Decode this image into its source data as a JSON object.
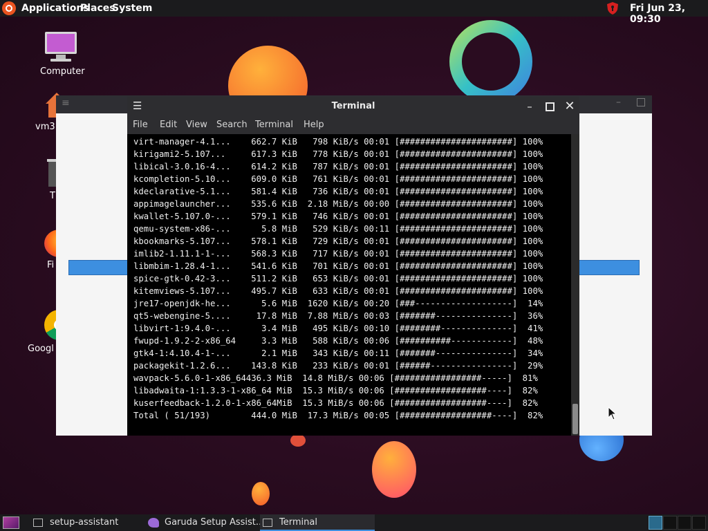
{
  "top_panel": {
    "menu_applications": "Applications",
    "menu_places": "Places",
    "menu_system": "System",
    "clock": "Fri Jun 23, 09:30"
  },
  "desktop_icons": [
    {
      "label": "Computer",
      "icon": "computer-icon"
    },
    {
      "label": "vm3",
      "icon": "home-folder-icon"
    },
    {
      "label": "T",
      "icon": "trash-icon"
    },
    {
      "label": "Fi",
      "icon": "firefox-icon"
    },
    {
      "label": "Googl",
      "icon": "chrome-icon"
    }
  ],
  "terminal": {
    "title": "Terminal",
    "menu": [
      "File",
      "Edit",
      "View",
      "Search",
      "Terminal",
      "Help"
    ],
    "lines": [
      "virt-manager-4.1...    662.7 KiB   798 KiB/s 00:01 [######################] 100%",
      "kirigami2-5.107...     617.3 KiB   778 KiB/s 00:01 [######################] 100%",
      "libical-3.0.16-4...    614.2 KiB   787 KiB/s 00:01 [######################] 100%",
      "kcompletion-5.10...    609.0 KiB   761 KiB/s 00:01 [######################] 100%",
      "kdeclarative-5.1...    581.4 KiB   736 KiB/s 00:01 [######################] 100%",
      "appimagelauncher...    535.6 KiB  2.18 MiB/s 00:00 [######################] 100%",
      "kwallet-5.107.0-...    579.1 KiB   746 KiB/s 00:01 [######################] 100%",
      "qemu-system-x86-...      5.8 MiB   529 KiB/s 00:11 [######################] 100%",
      "kbookmarks-5.107...    578.1 KiB   729 KiB/s 00:01 [######################] 100%",
      "imlib2-1.11.1-1-...    568.3 KiB   717 KiB/s 00:01 [######################] 100%",
      "libmbim-1.28.4-1...    541.6 KiB   701 KiB/s 00:01 [######################] 100%",
      "spice-gtk-0.42-3...    511.2 KiB   653 KiB/s 00:01 [######################] 100%",
      "kitemviews-5.107...    495.7 KiB   633 KiB/s 00:01 [######################] 100%",
      "jre17-openjdk-he...      5.6 MiB  1620 KiB/s 00:20 [###-------------------]  14%",
      "qt5-webengine-5....     17.8 MiB  7.88 MiB/s 00:03 [#######---------------]  36%",
      "libvirt-1:9.4.0-...      3.4 MiB   495 KiB/s 00:10 [########--------------]  41%",
      "fwupd-1.9.2-2-x86_64     3.3 MiB   588 KiB/s 00:06 [##########------------]  48%",
      "gtk4-1:4.10.4-1-...      2.1 MiB   343 KiB/s 00:11 [#######---------------]  34%",
      "packagekit-1.2.6...    143.8 KiB   233 KiB/s 00:01 [######----------------]  29%",
      "wavpack-5.6.0-1-x86_64436.3 MiB  14.8 MiB/s 00:06 [#################-----]  81%",
      "libadwaita-1:1.3.3-1-x86_64 MiB  15.3 MiB/s 00:06 [##################----]  82%",
      "kuserfeedback-1.2.0-1-x86_64MiB  15.3 MiB/s 00:06 [##################----]  82%",
      "Total ( 51/193)        444.0 MiB  17.3 MiB/s 00:05 [##################----]  82%"
    ]
  },
  "taskbar": {
    "tasks": [
      {
        "label": "setup-assistant",
        "icon": "terminal-icon"
      },
      {
        "label": "Garuda Setup Assist...",
        "icon": "garuda-icon"
      },
      {
        "label": "Terminal",
        "icon": "terminal-icon"
      }
    ]
  },
  "colors": {
    "accent": "#3d8fe0",
    "ubuntu_orange": "#e95420",
    "active_task_underline": "#3d8fe0"
  }
}
